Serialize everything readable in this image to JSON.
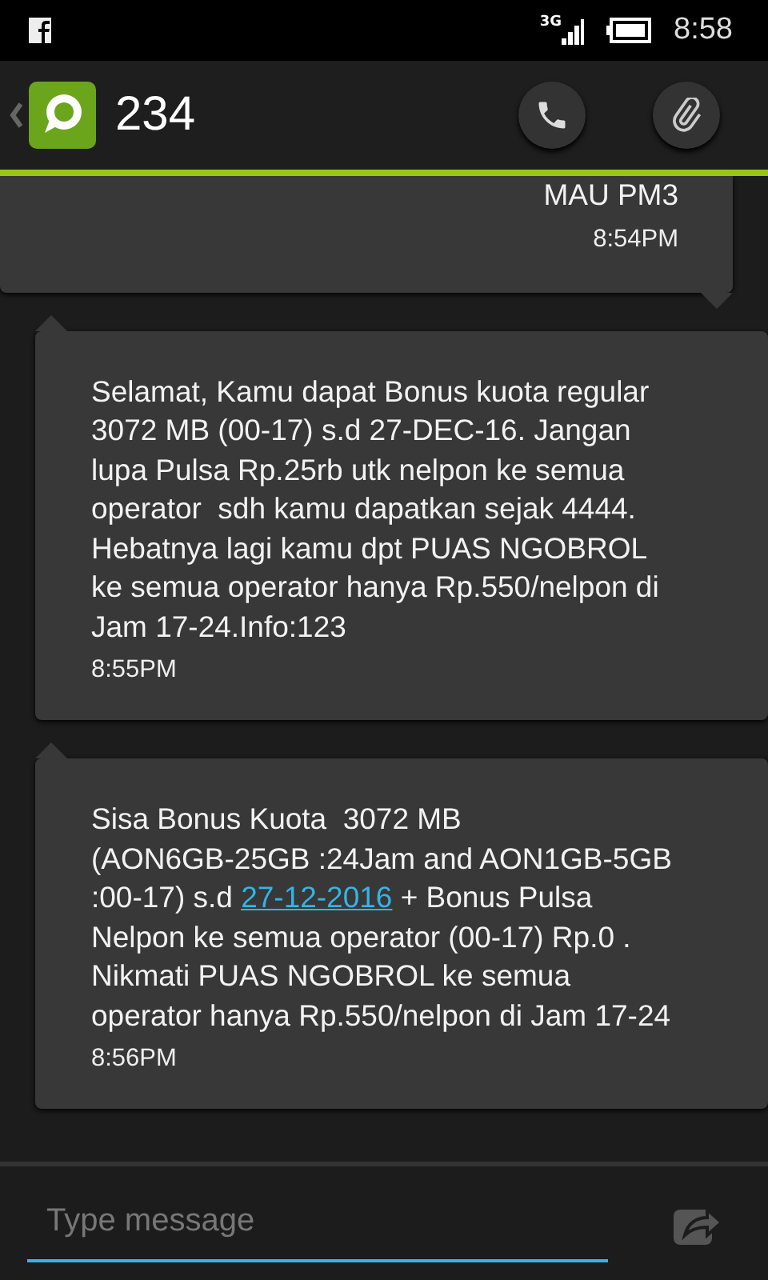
{
  "status_bar": {
    "network": "3G",
    "time": "8:58"
  },
  "header": {
    "contact": "234"
  },
  "messages": [
    {
      "sent": true,
      "body": [
        {
          "kind": "text",
          "text": "MAU PM3"
        }
      ],
      "time": "8:54PM"
    },
    {
      "sent": false,
      "body": [
        {
          "kind": "text",
          "text": "Selamat, Kamu dapat Bonus kuota regular\n3072 MB (00-17) s.d 27-DEC-16. Jangan\nlupa Pulsa Rp.25rb utk nelpon ke semua\noperator  sdh kamu dapatkan sejak 4444.\nHebatnya lagi kamu dpt PUAS NGOBROL\nke semua operator hanya Rp.550/nelpon di\nJam 17-24.Info:123"
        }
      ],
      "time": "8:55PM"
    },
    {
      "sent": false,
      "body": [
        {
          "kind": "text",
          "text": "Sisa Bonus Kuota  3072 MB\n(AON6GB-25GB :24Jam and AON1GB-5GB\n:00-17) s.d "
        },
        {
          "kind": "link",
          "text": "27-12-2016"
        },
        {
          "kind": "text",
          "text": " + Bonus Pulsa\nNelpon ke semua operator (00-17) Rp.0 .\nNikmati PUAS NGOBROL ke semua\noperator hanya Rp.550/nelpon di Jam 17-24"
        }
      ],
      "time": "8:56PM"
    }
  ],
  "composer": {
    "placeholder": "Type message"
  }
}
